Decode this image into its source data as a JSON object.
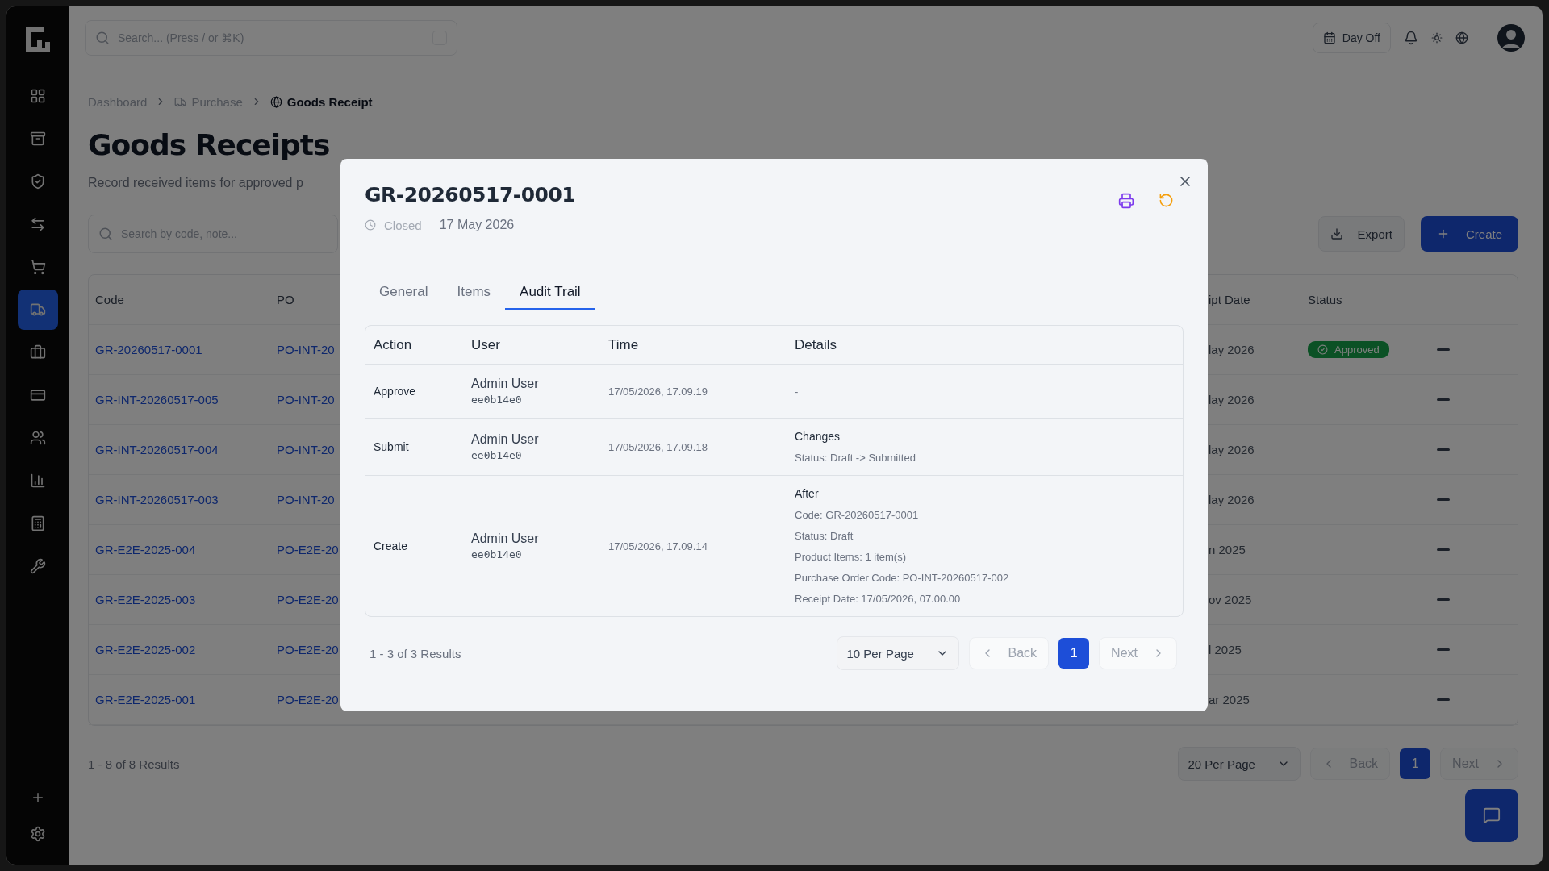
{
  "sidebar": {
    "items": [
      {
        "selected": false
      },
      {
        "selected": false
      },
      {
        "selected": false
      },
      {
        "selected": false
      },
      {
        "selected": false
      },
      {
        "selected": true
      },
      {
        "selected": false
      },
      {
        "selected": false
      },
      {
        "selected": false
      },
      {
        "selected": false
      },
      {
        "selected": false
      },
      {
        "selected": false
      }
    ]
  },
  "topbar": {
    "search": {
      "placeholder": "Search... (Press / or ⌘K)"
    },
    "day_off": "Day Off"
  },
  "breadcrumbs": [
    {
      "label": "Dashboard",
      "current": false
    },
    {
      "label": "Purchase",
      "current": false
    },
    {
      "label": "Goods Receipt",
      "current": true
    }
  ],
  "page": {
    "title": "Goods Receipts",
    "subtitle": "Record received items for approved p",
    "search": {
      "placeholder": "Search by code, note..."
    },
    "export": "Export",
    "create": "Create"
  },
  "table": {
    "columns": [
      "Code",
      "PO",
      "ipt Date",
      "Status"
    ],
    "rows": [
      {
        "code": "GR-20260517-0001",
        "po": "PO-INT-20",
        "date": "lay 2026",
        "status": "Approved"
      },
      {
        "code": "GR-INT-20260517-005",
        "po": "PO-INT-20",
        "date": "lay 2026"
      },
      {
        "code": "GR-INT-20260517-004",
        "po": "PO-INT-20",
        "date": "lay 2026"
      },
      {
        "code": "GR-INT-20260517-003",
        "po": "PO-INT-20",
        "date": "lay 2026"
      },
      {
        "code": "GR-E2E-2025-004",
        "po": "PO-E2E-20",
        "date": "n 2025"
      },
      {
        "code": "GR-E2E-2025-003",
        "po": "PO-E2E-20",
        "date": "ov 2025"
      },
      {
        "code": "GR-E2E-2025-002",
        "po": "PO-E2E-20",
        "date": "l 2025"
      },
      {
        "code": "GR-E2E-2025-001",
        "po": "PO-E2E-20",
        "date": "ar 2025"
      }
    ]
  },
  "pagination": {
    "results": "1 - 8 of 8 Results",
    "per_page": "20 Per Page",
    "back": "Back",
    "page": "1",
    "next": "Next"
  },
  "modal": {
    "title": "GR-20260517-0001",
    "status": "Closed",
    "date": "17 May 2026",
    "tabs": [
      {
        "label": "General",
        "selected": false
      },
      {
        "label": "Items",
        "selected": false
      },
      {
        "label": "Audit Trail",
        "selected": true
      }
    ],
    "audit": {
      "columns": [
        "Action",
        "User",
        "Time",
        "Details"
      ],
      "rows": [
        {
          "action": "Approve",
          "user": "Admin User",
          "user_id": "ee0b14e0",
          "time": "17/05/2026, 17.09.19",
          "details": {
            "lines": [
              "-"
            ]
          }
        },
        {
          "action": "Submit",
          "user": "Admin User",
          "user_id": "ee0b14e0",
          "time": "17/05/2026, 17.09.18",
          "details": {
            "heading": "Changes",
            "lines": [
              "Status: Draft -> Submitted"
            ]
          }
        },
        {
          "action": "Create",
          "user": "Admin User",
          "user_id": "ee0b14e0",
          "time": "17/05/2026, 17.09.14",
          "details": {
            "heading": "After",
            "lines": [
              "Code: GR-20260517-0001",
              "Status: Draft",
              "Product Items: 1 item(s)",
              "Purchase Order Code: PO-INT-20260517-002",
              "Receipt Date: 17/05/2026, 07.00.00"
            ]
          }
        }
      ]
    },
    "pagination": {
      "results": "1 - 3 of 3 Results",
      "per_page": "10 Per Page",
      "back": "Back",
      "page": "1",
      "next": "Next"
    }
  }
}
